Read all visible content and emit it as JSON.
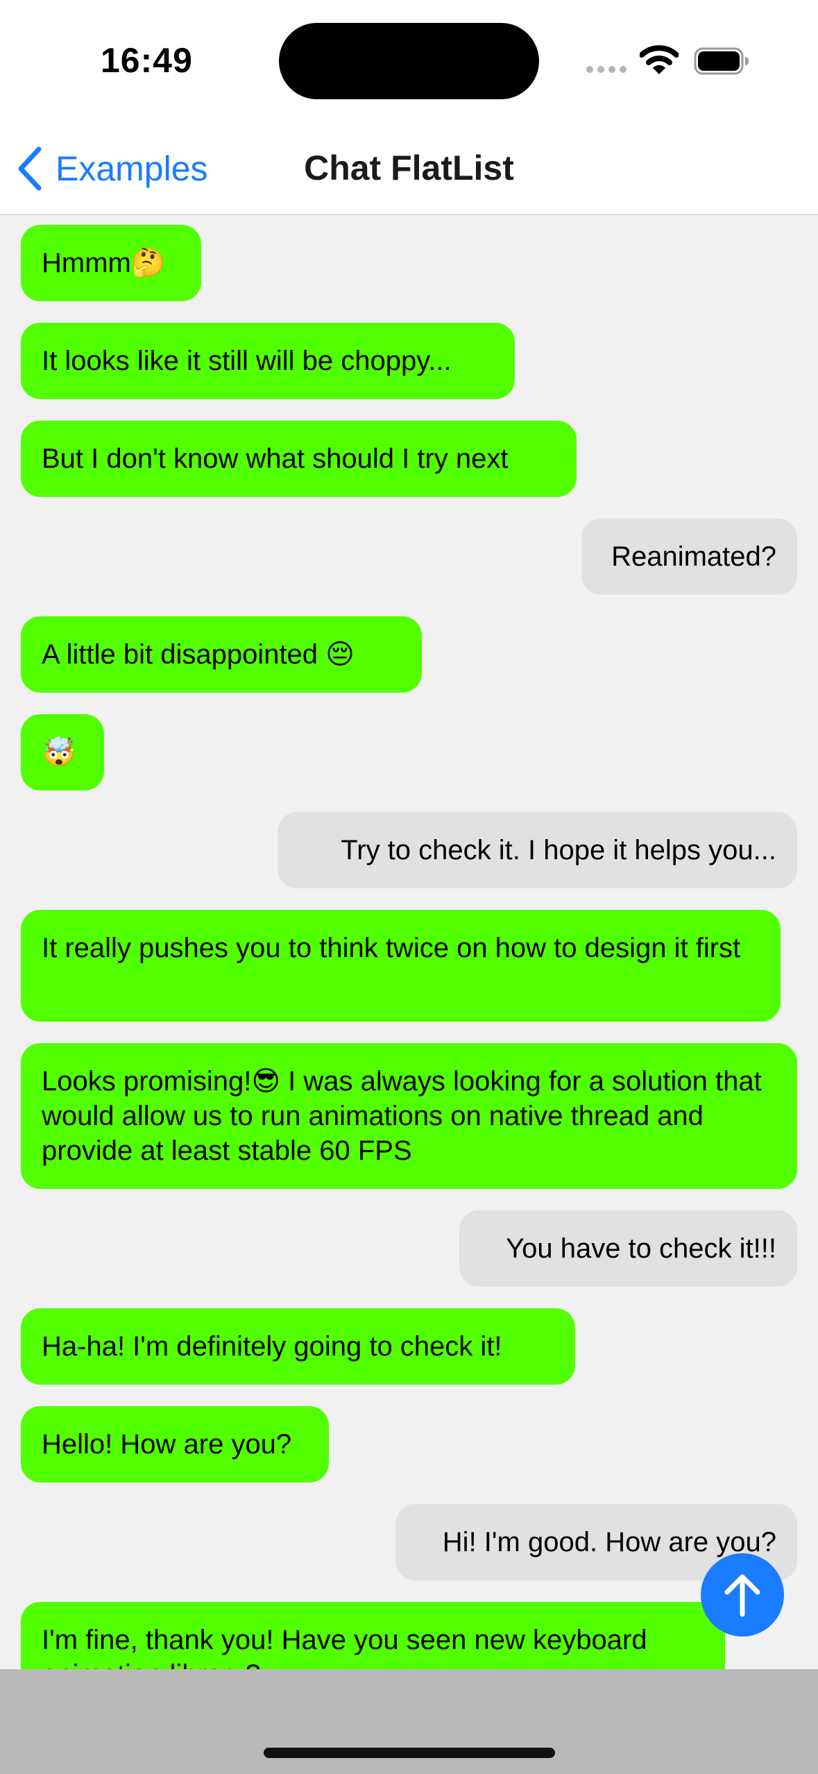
{
  "status_bar": {
    "time": "16:49",
    "icons": [
      "cellular-signal-icon",
      "wifi-icon",
      "battery-icon"
    ]
  },
  "nav": {
    "back_label": "Examples",
    "title": "Chat FlatList",
    "accent_color": "#1a7cff"
  },
  "colors": {
    "received_bubble": "#52ff00",
    "sent_bubble": "#e1e1e1",
    "background": "#f1f1f1",
    "fab": "#1a7cff"
  },
  "messages": [
    {
      "sender": "other",
      "text": "Hmmm🤔"
    },
    {
      "sender": "other",
      "text": "It looks like it still will be choppy..."
    },
    {
      "sender": "other",
      "text": "But I don't know what should I try next"
    },
    {
      "sender": "me",
      "text": "Reanimated?"
    },
    {
      "sender": "other",
      "text": "A little bit disappointed 😔"
    },
    {
      "sender": "other",
      "text": "🤯"
    },
    {
      "sender": "me",
      "text": "Try to check it. I hope it helps you..."
    },
    {
      "sender": "other",
      "text": "It really pushes you to think twice on how to design it first"
    },
    {
      "sender": "other",
      "text": "Looks promising!😎 I was always looking for a solution that would allow us to run animations on native thread and provide at least stable 60 FPS"
    },
    {
      "sender": "me",
      "text": "You have to check it!!!"
    },
    {
      "sender": "other",
      "text": "Ha-ha! I'm definitely going to check it!"
    },
    {
      "sender": "other",
      "text": "Hello! How are you?"
    },
    {
      "sender": "me",
      "text": "Hi! I'm good. How are you?"
    },
    {
      "sender": "other",
      "text": "I'm fine, thank you! Have you seen new keyboard animation library?"
    }
  ],
  "fab": {
    "icon": "arrow-up-icon"
  }
}
